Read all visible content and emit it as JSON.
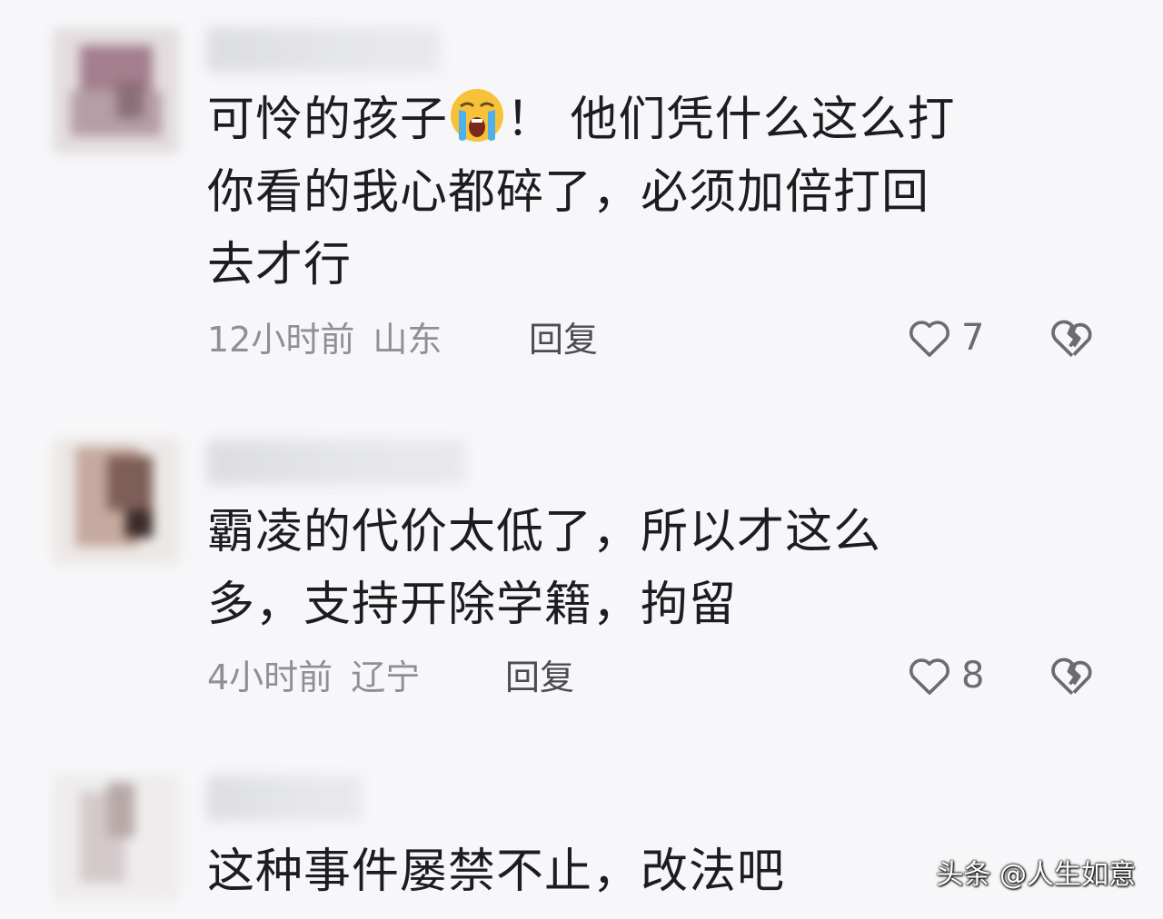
{
  "comments": [
    {
      "lines": [
        "可怜的孩子",
        "你看的我心都碎了，必须加倍打回",
        "去才行"
      ],
      "line1_after_emoji": "！ 他们凭什么这么打",
      "emoji": "loudly-crying-face",
      "time": "12小时前",
      "location": "山东",
      "reply_label": "回复",
      "likes": "7"
    },
    {
      "lines": [
        "霸凌的代价太低了，所以才这么",
        "多，支持开除学籍，拘留"
      ],
      "time": "4小时前",
      "location": "辽宁",
      "reply_label": "回复",
      "likes": "8"
    },
    {
      "lines": [
        "这种事件屡禁不止，改法吧"
      ]
    }
  ],
  "watermark": "头条 @人生如意",
  "colors": {
    "background": "#f7f7f9",
    "text": "#1d1d1f",
    "meta": "#8f8f94",
    "icon": "#6b6b70"
  }
}
